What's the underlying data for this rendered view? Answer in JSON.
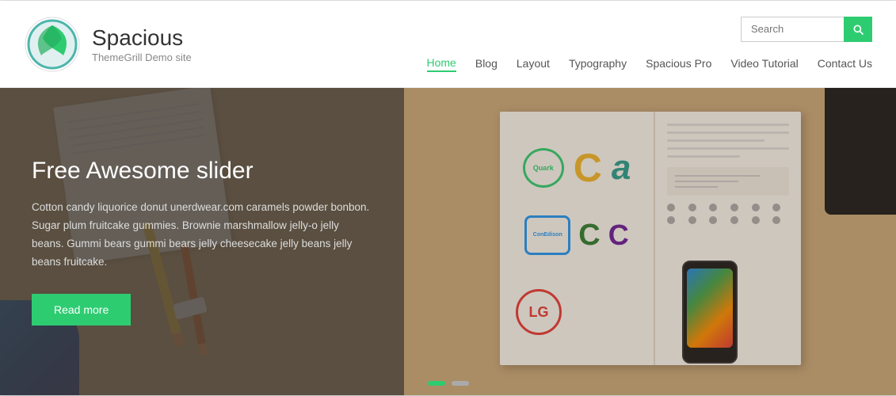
{
  "site": {
    "title": "Spacious",
    "tagline": "ThemeGrill Demo site"
  },
  "header": {
    "search_placeholder": "Search",
    "search_button_label": "Search"
  },
  "nav": {
    "items": [
      {
        "id": "home",
        "label": "Home",
        "active": true
      },
      {
        "id": "blog",
        "label": "Blog",
        "active": false
      },
      {
        "id": "layout",
        "label": "Layout",
        "active": false
      },
      {
        "id": "typography",
        "label": "Typography",
        "active": false
      },
      {
        "id": "spacious-pro",
        "label": "Spacious Pro",
        "active": false
      },
      {
        "id": "video-tutorial",
        "label": "Video Tutorial",
        "active": false
      },
      {
        "id": "contact-us",
        "label": "Contact Us",
        "active": false
      }
    ]
  },
  "hero": {
    "title": "Free Awesome slider",
    "description": "Cotton candy liquorice donut unerdwear.com caramels powder bonbon. Sugar plum fruitcake gummies. Brownie marshmallow jelly-o jelly beans. Gummi bears gummi bears jelly cheesecake jelly beans jelly beans fruitcake.",
    "cta_label": "Read more"
  },
  "slider": {
    "dots": [
      {
        "active": true
      },
      {
        "active": false
      }
    ]
  },
  "colors": {
    "accent": "#2ecc71",
    "nav_active": "#2ecc71",
    "dark_overlay": "rgba(60,55,50,0.72)"
  }
}
